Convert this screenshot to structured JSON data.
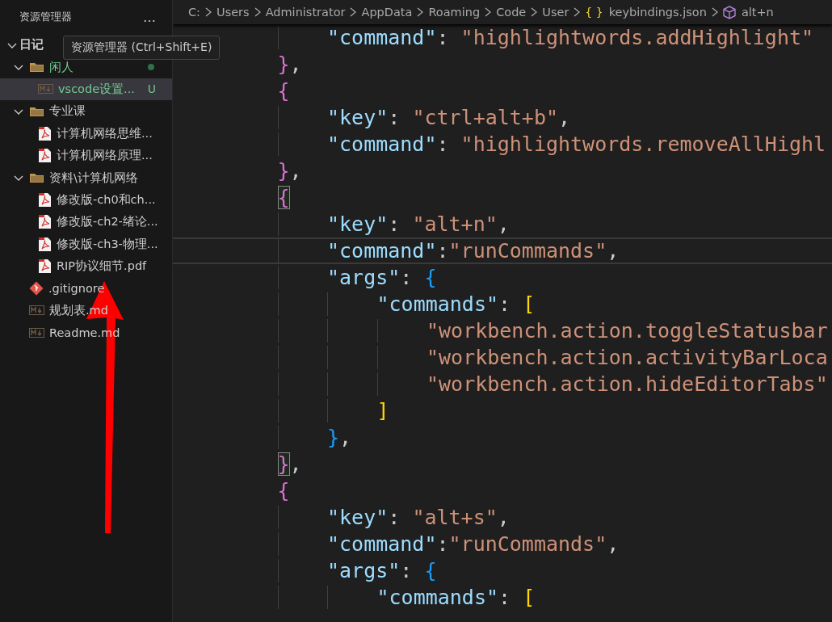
{
  "sidebar": {
    "title": "资源管理器",
    "more": "…",
    "tooltip": "资源管理器 (Ctrl+Shift+E)",
    "tree": [
      {
        "label": "日记",
        "kind": "root",
        "expanded": true,
        "selected": false,
        "changed": false,
        "children": [
          {
            "label": "闲人",
            "kind": "folder",
            "expanded": true,
            "selected": false,
            "changed": true,
            "children": [
              {
                "label": "vscode设置...",
                "kind": "md",
                "selected": true,
                "changed": true,
                "badge": "U"
              }
            ]
          },
          {
            "label": "专业课",
            "kind": "folder",
            "expanded": true,
            "selected": false,
            "changed": false,
            "children": [
              {
                "label": "计算机网络思维...",
                "kind": "pdf",
                "selected": false,
                "changed": false
              },
              {
                "label": "计算机网络原理...",
                "kind": "pdf",
                "selected": false,
                "changed": false
              }
            ]
          },
          {
            "label": "资料\\计算机网络",
            "kind": "folder",
            "expanded": true,
            "selected": false,
            "changed": false,
            "children": [
              {
                "label": "修改版-ch0和ch...",
                "kind": "pdf",
                "selected": false,
                "changed": false
              },
              {
                "label": "修改版-ch2-绪论...",
                "kind": "pdf",
                "selected": false,
                "changed": false
              },
              {
                "label": "修改版-ch3-物理...",
                "kind": "pdf",
                "selected": false,
                "changed": false
              },
              {
                "label": "RIP协议细节.pdf",
                "kind": "pdf",
                "selected": false,
                "changed": false
              }
            ]
          },
          {
            "label": ".gitignore",
            "kind": "git",
            "selected": false,
            "changed": false
          },
          {
            "label": "规划表.md",
            "kind": "md",
            "selected": false,
            "changed": false
          },
          {
            "label": "Readme.md",
            "kind": "md",
            "selected": false,
            "changed": false
          }
        ]
      }
    ]
  },
  "breadcrumb": [
    {
      "label": "C:",
      "kind": "folder"
    },
    {
      "label": "Users",
      "kind": "folder"
    },
    {
      "label": "Administrator",
      "kind": "folder"
    },
    {
      "label": "AppData",
      "kind": "folder"
    },
    {
      "label": "Roaming",
      "kind": "folder"
    },
    {
      "label": "Code",
      "kind": "folder"
    },
    {
      "label": "User",
      "kind": "folder"
    },
    {
      "label": "keybindings.json",
      "kind": "json",
      "glyph": "{ }"
    },
    {
      "label": "alt+n",
      "kind": "symbol"
    }
  ],
  "editor": {
    "lines": [
      {
        "current": false,
        "tokens": [
          {
            "kind": "key",
            "t": "\"command\""
          },
          {
            "kind": "punct",
            "t": ": "
          },
          {
            "kind": "str",
            "t": "\"highlightwords.addHighlight\""
          }
        ]
      },
      {
        "current": false,
        "tokens": [
          {
            "kind": "close",
            "t": "}",
            "matched": false
          },
          {
            "kind": "punct",
            "t": ","
          }
        ]
      },
      {
        "current": false,
        "tokens": [
          {
            "kind": "open",
            "t": "{",
            "matched": false
          }
        ]
      },
      {
        "current": false,
        "tokens": [
          {
            "kind": "key",
            "t": "\"key\""
          },
          {
            "kind": "punct",
            "t": ": "
          },
          {
            "kind": "str",
            "t": "\"ctrl+alt+b\""
          },
          {
            "kind": "punct",
            "t": ","
          }
        ]
      },
      {
        "current": false,
        "tokens": [
          {
            "kind": "key",
            "t": "\"command\""
          },
          {
            "kind": "punct",
            "t": ": "
          },
          {
            "kind": "str",
            "t": "\"highlightwords.removeAllHighl"
          }
        ]
      },
      {
        "current": false,
        "tokens": [
          {
            "kind": "close",
            "t": "}",
            "matched": false
          },
          {
            "kind": "punct",
            "t": ","
          }
        ]
      },
      {
        "current": false,
        "tokens": [
          {
            "kind": "open",
            "t": "{",
            "matched": true
          }
        ]
      },
      {
        "current": false,
        "tokens": [
          {
            "kind": "key",
            "t": "\"key\""
          },
          {
            "kind": "punct",
            "t": ": "
          },
          {
            "kind": "str",
            "t": "\"alt+n\""
          },
          {
            "kind": "punct",
            "t": ","
          }
        ]
      },
      {
        "current": true,
        "tokens": [
          {
            "kind": "key",
            "t": "\"command\""
          },
          {
            "kind": "punct",
            "t": ":"
          },
          {
            "kind": "str",
            "t": "\"runCommands\""
          },
          {
            "kind": "punct",
            "t": ","
          }
        ]
      },
      {
        "current": false,
        "tokens": [
          {
            "kind": "key",
            "t": "\"args\""
          },
          {
            "kind": "punct",
            "t": ": "
          },
          {
            "kind": "open",
            "t": "{",
            "matched": false
          }
        ]
      },
      {
        "current": false,
        "tokens": [
          {
            "kind": "key",
            "t": "\"commands\""
          },
          {
            "kind": "punct",
            "t": ": "
          },
          {
            "kind": "open",
            "t": "[",
            "matched": false
          }
        ]
      },
      {
        "current": false,
        "tokens": [
          {
            "kind": "str",
            "t": "\"workbench.action.toggleStatusbar"
          }
        ]
      },
      {
        "current": false,
        "tokens": [
          {
            "kind": "str",
            "t": "\"workbench.action.activityBarLoca"
          }
        ]
      },
      {
        "current": false,
        "tokens": [
          {
            "kind": "str",
            "t": "\"workbench.action.hideEditorTabs\""
          }
        ]
      },
      {
        "current": false,
        "tokens": [
          {
            "kind": "close",
            "t": "]",
            "matched": false
          }
        ]
      },
      {
        "current": false,
        "tokens": [
          {
            "kind": "close",
            "t": "}",
            "matched": false
          },
          {
            "kind": "punct",
            "t": ","
          }
        ]
      },
      {
        "current": false,
        "tokens": [
          {
            "kind": "close",
            "t": "}",
            "matched": true
          },
          {
            "kind": "punct",
            "t": ","
          }
        ]
      },
      {
        "current": false,
        "tokens": [
          {
            "kind": "open",
            "t": "{",
            "matched": false
          }
        ]
      },
      {
        "current": false,
        "tokens": [
          {
            "kind": "key",
            "t": "\"key\""
          },
          {
            "kind": "punct",
            "t": ": "
          },
          {
            "kind": "str",
            "t": "\"alt+s\""
          },
          {
            "kind": "punct",
            "t": ","
          }
        ]
      },
      {
        "current": false,
        "tokens": [
          {
            "kind": "key",
            "t": "\"command\""
          },
          {
            "kind": "punct",
            "t": ":"
          },
          {
            "kind": "str",
            "t": "\"runCommands\""
          },
          {
            "kind": "punct",
            "t": ","
          }
        ]
      },
      {
        "current": false,
        "tokens": [
          {
            "kind": "key",
            "t": "\"args\""
          },
          {
            "kind": "punct",
            "t": ": "
          },
          {
            "kind": "open",
            "t": "{",
            "matched": false
          }
        ]
      },
      {
        "current": false,
        "tokens": [
          {
            "kind": "key",
            "t": "\"commands\""
          },
          {
            "kind": "punct",
            "t": ": "
          },
          {
            "kind": "open",
            "t": "[",
            "matched": false
          }
        ]
      }
    ]
  }
}
